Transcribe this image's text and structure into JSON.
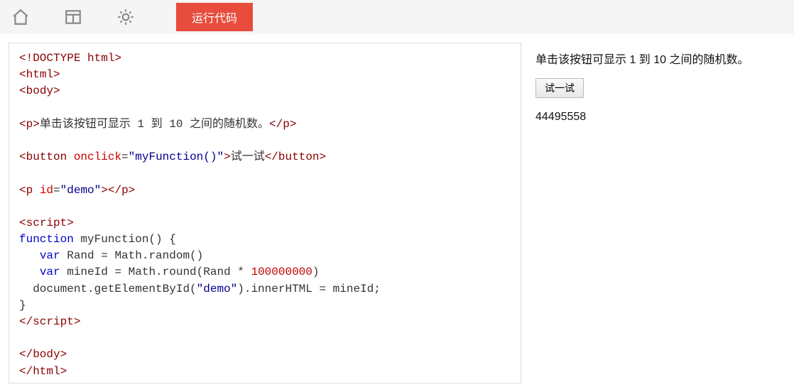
{
  "toolbar": {
    "home_icon": "home-icon",
    "layout_icon": "layout-icon",
    "theme_icon": "sun-icon",
    "run_label": "运行代码"
  },
  "code": {
    "l1_a": "<!DOCTYPE html>",
    "l2_open": "<",
    "l2_tag": "html",
    "l2_close": ">",
    "l3_open": "<",
    "l3_tag": "body",
    "l3_close": ">",
    "l4_open": "<",
    "l4_tag": "p",
    "l4_close": ">",
    "l4_txt": "单击该按钮可显示 1 到 10 之间的随机数。",
    "l4_copen": "</",
    "l4_ctag": "p",
    "l4_cend": ">",
    "l5_open": "<",
    "l5_tag": "button",
    "l5_sp": " ",
    "l5_attr": "onclick",
    "l5_eq": "=",
    "l5_val": "\"myFunction()\"",
    "l5_close": ">",
    "l5_txt": "试一试",
    "l5_copen": "</",
    "l5_ctag": "button",
    "l5_cend": ">",
    "l6_open": "<",
    "l6_tag": "p",
    "l6_sp": " ",
    "l6_attr": "id",
    "l6_eq": "=",
    "l6_val": "\"demo\"",
    "l6_close": ">",
    "l6_copen": "</",
    "l6_ctag": "p",
    "l6_cend": ">",
    "l7_open": "<",
    "l7_tag": "script",
    "l7_close": ">",
    "l8_kw": "function",
    "l8_name": " myFunction() {",
    "l9_prefix": "   ",
    "l9_kw": "var",
    "l9_rest": " Rand = Math.random()",
    "l10_prefix": "   ",
    "l10_kw": "var",
    "l10_mid": " mineId = Math.round(Rand * ",
    "l10_num": "100000000",
    "l10_end": ")",
    "l11_prefix": "  document.getElementById(",
    "l11_str": "\"demo\"",
    "l11_end": ").innerHTML = mineId;",
    "l12": "}",
    "l13_open": "</",
    "l13_tag": "script",
    "l13_close": ">",
    "l14_open": "</",
    "l14_tag": "body",
    "l14_close": ">",
    "l15_open": "</",
    "l15_tag": "html",
    "l15_close": ">"
  },
  "preview": {
    "text": "单击该按钮可显示 1 到 10 之间的随机数。",
    "button_label": "试一试",
    "demo_value": "44495558"
  }
}
